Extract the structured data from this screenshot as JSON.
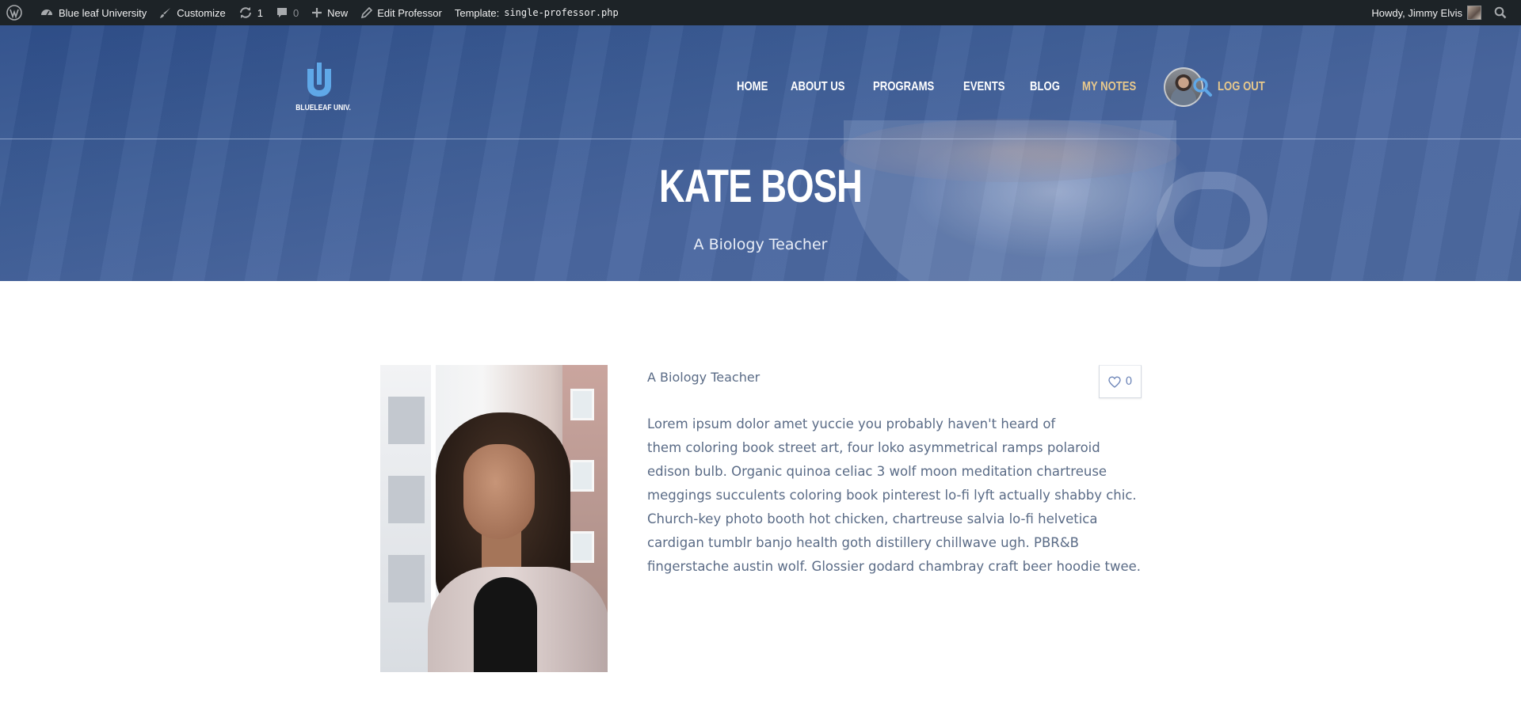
{
  "admin_bar": {
    "site_name": "Blue leaf University",
    "customize": "Customize",
    "updates_count": "1",
    "comments_count": "0",
    "new_label": "New",
    "edit_label": "Edit Professor",
    "template_label": "Template:",
    "template_file": "single-professor.php",
    "greeting": "Howdy, Jimmy Elvis",
    "icons": [
      "wordpress-icon",
      "dashboard-icon",
      "brush-icon",
      "refresh-icon",
      "comment-icon",
      "plus-icon",
      "pencil-icon",
      "search-icon"
    ]
  },
  "header": {
    "logo_text": "BLUELEAF UNIV.",
    "nav": {
      "home": "HOME",
      "about": "ABOUT US",
      "programs": "PROGRAMS",
      "events": "EVENTS",
      "blog": "BLOG",
      "my_notes": "MY NOTES",
      "logout": "LOG OUT"
    },
    "accent_color": "#e8c98c",
    "search_color": "#5fa8e8"
  },
  "hero": {
    "title": "KATE BOSH",
    "subtitle": "A Biology Teacher"
  },
  "professor": {
    "subtitle": "A Biology Teacher",
    "likes": "0",
    "bio_lines": [
      "Lorem ipsum dolor amet yuccie you probably haven't heard of",
      "them coloring book street art, four loko asymmetrical ramps polaroid",
      "edison bulb. Organic quinoa celiac 3 wolf moon meditation chartreuse",
      "meggings succulents coloring book pinterest lo-fi lyft actually shabby chic.",
      "Church-key photo booth hot chicken, chartreuse salvia lo-fi helvetica",
      "cardigan tumblr banjo health goth distillery chillwave ugh. PBR&B",
      "fingerstache austin wolf. Glossier godard chambray craft beer hoodie twee."
    ]
  }
}
